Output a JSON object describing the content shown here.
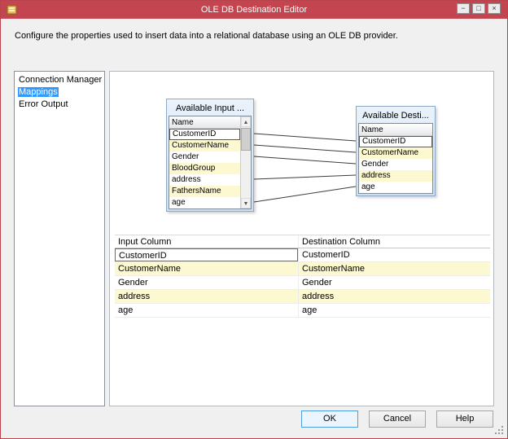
{
  "window": {
    "title": "OLE DB Destination Editor",
    "description": "Configure the properties used to insert data into a relational database using an OLE DB provider.",
    "controls": {
      "minimize": "−",
      "maximize": "□",
      "close": "×"
    }
  },
  "sidebar": {
    "items": [
      {
        "label": "Connection Manager",
        "selected": false
      },
      {
        "label": "Mappings",
        "selected": true
      },
      {
        "label": "Error Output",
        "selected": false
      }
    ]
  },
  "diagram": {
    "input_box": {
      "title": "Available Input ...",
      "header": "Name",
      "rows": [
        "CustomerID",
        "CustomerName",
        "Gender",
        "BloodGroup",
        "address",
        "FathersName",
        "age"
      ]
    },
    "dest_box": {
      "title": "Available Desti...",
      "header": "Name",
      "rows": [
        "CustomerID",
        "CustomerName",
        "Gender",
        "address",
        "age"
      ]
    },
    "scrollbar": {
      "up": "▲",
      "down": "▼"
    }
  },
  "mapping_table": {
    "columns": [
      "Input Column",
      "Destination Column"
    ],
    "rows": [
      [
        "CustomerID",
        "CustomerID"
      ],
      [
        "CustomerName",
        "CustomerName"
      ],
      [
        "Gender",
        "Gender"
      ],
      [
        "address",
        "address"
      ],
      [
        "age",
        "age"
      ]
    ]
  },
  "buttons": {
    "ok": "OK",
    "cancel": "Cancel",
    "help": "Help"
  },
  "colors": {
    "titlebar": "#c2454f",
    "selection": "#3399ff",
    "alt_row": "#fcf8cf",
    "box_border": "#8fa9c9"
  }
}
